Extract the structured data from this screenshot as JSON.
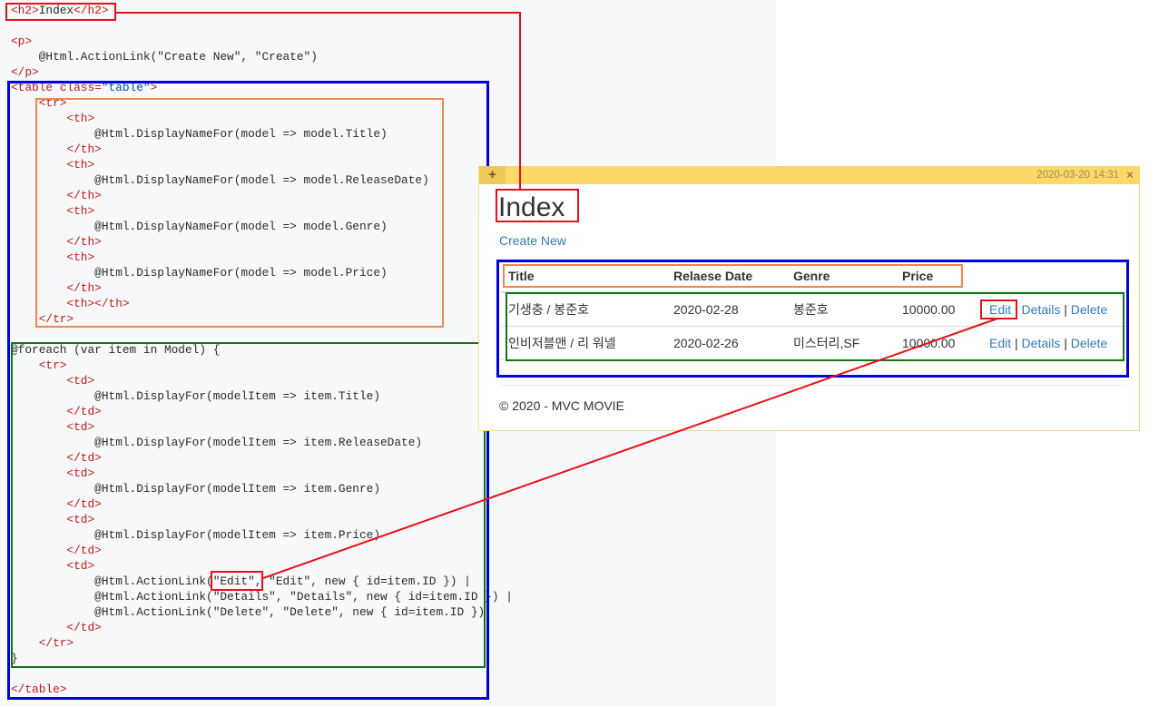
{
  "theme": {
    "code_background": "#f6f8fa",
    "code_text": "#2b2b2b",
    "text": "#333333",
    "link": "#337ab7",
    "note_header": "#fdd868",
    "note_border": "#f7dc7c",
    "annotation_red": "#e8111a",
    "annotation_blue": "#0000e1",
    "annotation_orange": "#f2874a",
    "annotation_green": "#127612"
  },
  "code": {
    "lines": [
      [
        {
          "text": "<h2>",
          "color": "#c41a16"
        },
        {
          "text": "Index"
        },
        {
          "text": "</h2>",
          "color": "#c41a16"
        }
      ],
      [],
      [
        {
          "text": "<p>",
          "color": "#c41a16"
        }
      ],
      [
        {
          "text": "    @Html.ActionLink(\"Create New\", \"Create\")"
        }
      ],
      [
        {
          "text": "</p>",
          "color": "#c41a16"
        }
      ],
      [
        {
          "text": "<table class=",
          "color": "#c41a16"
        },
        {
          "text": "\"table\"",
          "color": "#0451a5"
        },
        {
          "text": ">",
          "color": "#c41a16"
        }
      ],
      [
        {
          "text": "    <tr>",
          "color": "#c41a16"
        }
      ],
      [
        {
          "text": "        <th>",
          "color": "#c41a16"
        }
      ],
      [
        {
          "text": "            @Html.DisplayNameFor(model => model.Title)"
        }
      ],
      [
        {
          "text": "        </th>",
          "color": "#c41a16"
        }
      ],
      [
        {
          "text": "        <th>",
          "color": "#c41a16"
        }
      ],
      [
        {
          "text": "            @Html.DisplayNameFor(model => model.ReleaseDate)"
        }
      ],
      [
        {
          "text": "        </th>",
          "color": "#c41a16"
        }
      ],
      [
        {
          "text": "        <th>",
          "color": "#c41a16"
        }
      ],
      [
        {
          "text": "            @Html.DisplayNameFor(model => model.Genre)"
        }
      ],
      [
        {
          "text": "        </th>",
          "color": "#c41a16"
        }
      ],
      [
        {
          "text": "        <th>",
          "color": "#c41a16"
        }
      ],
      [
        {
          "text": "            @Html.DisplayNameFor(model => model.Price)"
        }
      ],
      [
        {
          "text": "        </th>",
          "color": "#c41a16"
        }
      ],
      [
        {
          "text": "        <th></th>",
          "color": "#c41a16"
        }
      ],
      [
        {
          "text": "    </tr>",
          "color": "#c41a16"
        }
      ],
      [],
      [
        {
          "text": "@foreach (var item in Model) {"
        }
      ],
      [
        {
          "text": "    <tr>",
          "color": "#c41a16"
        }
      ],
      [
        {
          "text": "        <td>",
          "color": "#c41a16"
        }
      ],
      [
        {
          "text": "            @Html.DisplayFor(modelItem => item.Title)"
        }
      ],
      [
        {
          "text": "        </td>",
          "color": "#c41a16"
        }
      ],
      [
        {
          "text": "        <td>",
          "color": "#c41a16"
        }
      ],
      [
        {
          "text": "            @Html.DisplayFor(modelItem => item.ReleaseDate)"
        }
      ],
      [
        {
          "text": "        </td>",
          "color": "#c41a16"
        }
      ],
      [
        {
          "text": "        <td>",
          "color": "#c41a16"
        }
      ],
      [
        {
          "text": "            @Html.DisplayFor(modelItem => item.Genre)"
        }
      ],
      [
        {
          "text": "        </td>",
          "color": "#c41a16"
        }
      ],
      [
        {
          "text": "        <td>",
          "color": "#c41a16"
        }
      ],
      [
        {
          "text": "            @Html.DisplayFor(modelItem => item.Price)"
        }
      ],
      [
        {
          "text": "        </td>",
          "color": "#c41a16"
        }
      ],
      [
        {
          "text": "        <td>",
          "color": "#c41a16"
        }
      ],
      [
        {
          "text": "            @Html.ActionLink(\"Edit\", \"Edit\", new { id=item.ID }) |"
        }
      ],
      [
        {
          "text": "            @Html.ActionLink(\"Details\", \"Details\", new { id=item.ID }) |"
        }
      ],
      [
        {
          "text": "            @Html.ActionLink(\"Delete\", \"Delete\", new { id=item.ID })"
        }
      ],
      [
        {
          "text": "        </td>",
          "color": "#c41a16"
        }
      ],
      [
        {
          "text": "    </tr>",
          "color": "#c41a16"
        }
      ],
      [
        {
          "text": "}"
        }
      ],
      [],
      [
        {
          "text": "</table>",
          "color": "#c41a16"
        }
      ]
    ]
  },
  "note": {
    "add_button_label": "+",
    "timestamp": "2020-03-20 14:31",
    "close_label": "×",
    "page": {
      "heading": "Index",
      "create_link": "Create New",
      "table": {
        "columns": [
          "Title",
          "Relaese Date",
          "Genre",
          "Price"
        ],
        "separator": "|",
        "rows": [
          {
            "cells": [
              "기생충 / 봉준호",
              "2020-02-28",
              "봉준호",
              "10000.00"
            ],
            "actions": [
              "Edit",
              "Details",
              "Delete"
            ]
          },
          {
            "cells": [
              "인비저블맨 / 리 워넬",
              "2020-02-26",
              "미스터리,SF",
              "10000.00"
            ],
            "actions": [
              "Edit",
              "Details",
              "Delete"
            ]
          }
        ]
      },
      "footer": "© 2020 - MVC MOVIE"
    }
  }
}
